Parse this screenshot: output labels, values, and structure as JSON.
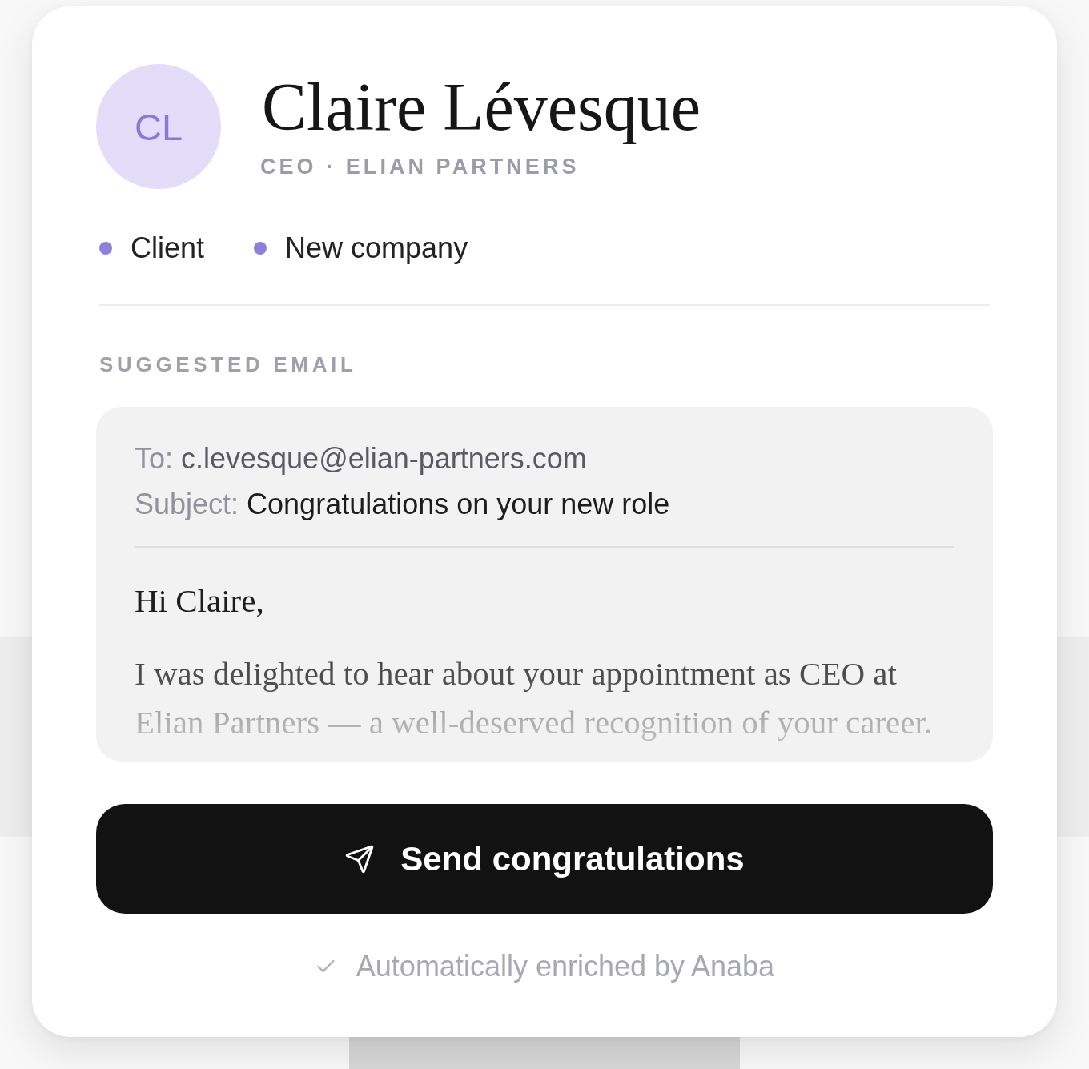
{
  "contact": {
    "initials": "CL",
    "name": "Claire Lévesque",
    "title": "CEO · ELIAN PARTNERS"
  },
  "tags": [
    {
      "label": "Client"
    },
    {
      "label": "New company"
    }
  ],
  "section_label": "SUGGESTED EMAIL",
  "email": {
    "fields": [
      {
        "kind": "recipient",
        "label": "To:",
        "value": "c.levesque@elian-partners.com"
      },
      {
        "kind": "subject",
        "label": "Subject:",
        "value": "Congratulations on your new role"
      }
    ],
    "greeting": "Hi Claire,",
    "body": "I was delighted to hear about your appointment as CEO at Elian Partners — a well-deserved recognition of your career."
  },
  "send_button": {
    "label": "Send congratulations"
  },
  "footer": {
    "note": "Automatically enriched by Anaba"
  }
}
